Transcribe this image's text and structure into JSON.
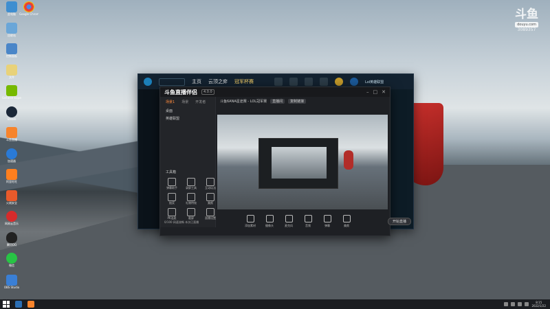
{
  "desktop": {
    "icons": [
      {
        "label": "此电脑",
        "color": "#3e8ed0"
      },
      {
        "label": "Google Chrome",
        "color": "#e9b64a"
      },
      {
        "label": "回收站",
        "color": "#6aa6d8"
      },
      {
        "label": "控制面板",
        "color": "#4a86c8"
      },
      {
        "label": "文件",
        "color": "#e8d27a"
      },
      {
        "label": "GeForce Experience",
        "color": "#76b900"
      },
      {
        "label": "Steam",
        "color": "#1b2838"
      },
      {
        "label": "斗鱼直播",
        "color": "#f7842c"
      },
      {
        "label": "加速器",
        "color": "#2a7ad6"
      },
      {
        "label": "阿里旺旺",
        "color": "#ff7f1e"
      },
      {
        "label": "火绒安全",
        "color": "#e85a2b"
      },
      {
        "label": "网易云音乐",
        "color": "#d62b2b"
      },
      {
        "label": "腾讯QQ",
        "color": "#222222"
      },
      {
        "label": "微信",
        "color": "#28c445"
      },
      {
        "label": "OBS Studio",
        "color": "#3a7fd5"
      }
    ]
  },
  "watermark": {
    "logo": "斗鱼",
    "tag": "douyu.com",
    "room": "3089357"
  },
  "game": {
    "nav": [
      "主页",
      "云顶之弈",
      "冠军杯赛"
    ],
    "username": "Lol英雄联盟"
  },
  "app": {
    "brand": "斗鱼直播伴侣",
    "version": "4.0.0",
    "left_tabs": [
      "场景1",
      "场景",
      "开发者"
    ],
    "scene_items": [
      "桌面",
      "英雄联盟"
    ],
    "tools_heading": "工具箱",
    "tools": [
      "弹幕助手",
      "录屏工具",
      "互动玩法",
      "抽奖",
      "礼物特效",
      "美颜",
      "PK连麦",
      "截屏",
      "直播设置"
    ],
    "room_title": "斗鱼6ANA星途赛 - LOL冠军赛",
    "room_badge": "直播间",
    "room_link": "复制链接",
    "controls": [
      "添加素材",
      "摄像头",
      "麦克风",
      "音频",
      "弹幕",
      "美颜"
    ],
    "live_button": "开始直播",
    "bottom_text": "0/100 网速流畅 本次已直播"
  },
  "taskbar": {
    "time": "8:15",
    "date": "2022/1/22"
  }
}
